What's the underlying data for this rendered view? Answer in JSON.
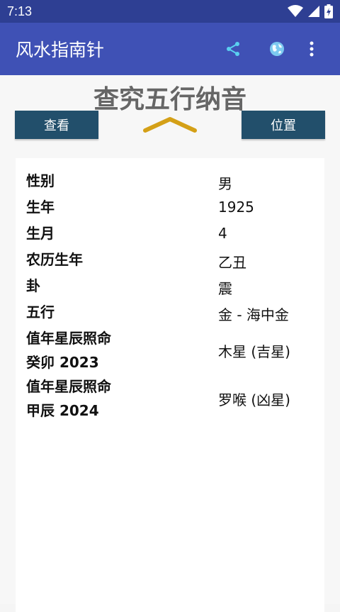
{
  "status_bar": {
    "time": "7:13"
  },
  "app_bar": {
    "title": "风水指南针",
    "icons": [
      "share-icon",
      "globe-icon",
      "more-vert-icon"
    ]
  },
  "main": {
    "heading": "查究五行纳音",
    "left_button": "查看",
    "right_button": "位置",
    "rows": [
      {
        "label": "性别",
        "value": "男"
      },
      {
        "label": "生年",
        "value": "1925"
      },
      {
        "label": "生月",
        "value": "4"
      },
      {
        "label": "农历生年",
        "value": "乙丑"
      },
      {
        "label": "卦",
        "value": "震"
      },
      {
        "label": "五行",
        "value": "金 - 海中金"
      },
      {
        "label_line1": "值年星辰照命",
        "label_line2": "癸卯 2023",
        "value": "木星 (吉星)"
      },
      {
        "label_line1": "值年星辰照命",
        "label_line2": "甲辰 2024",
        "value": "罗喉 (凶星)"
      }
    ]
  },
  "colors": {
    "status_bar": "#2e3f93",
    "app_bar": "#3f51b5",
    "button": "#224f6b",
    "chevron": "#d4a017",
    "heading": "#666666"
  }
}
